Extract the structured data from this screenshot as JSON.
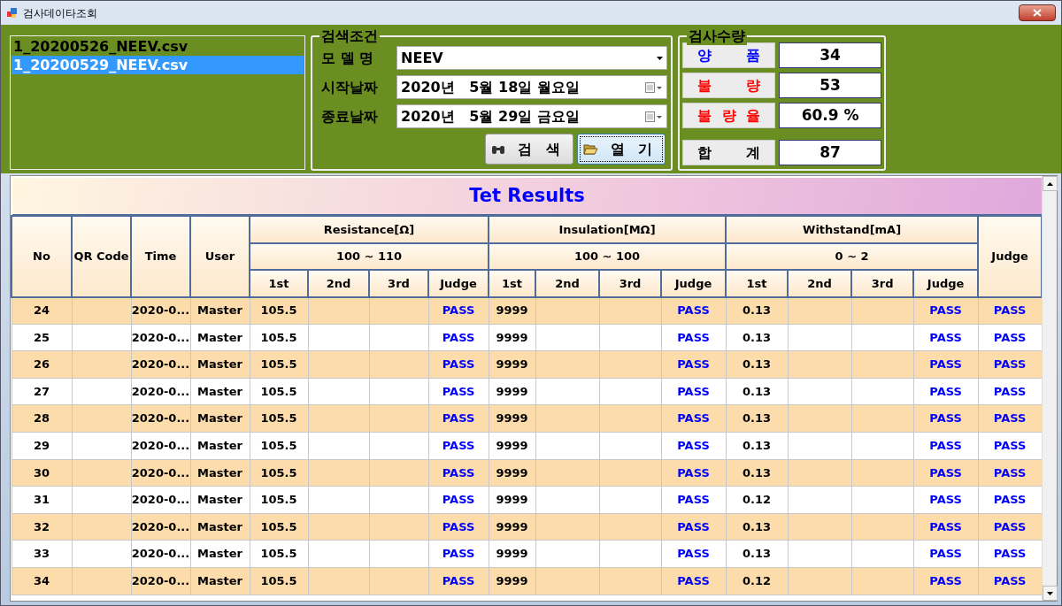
{
  "window": {
    "title": "검사데이타조회"
  },
  "file_list": [
    {
      "name": "1_20200526_NEEV.csv",
      "selected": false
    },
    {
      "name": "1_20200529_NEEV.csv",
      "selected": true
    }
  ],
  "search_conditions": {
    "title": "검색조건",
    "fields": [
      {
        "label": "모 델 명",
        "value": "NEEV",
        "kind": "dropdown"
      },
      {
        "label": "시작날짜",
        "value": "2020년   5월 18일 월요일",
        "kind": "date"
      },
      {
        "label": "종료날짜",
        "value": "2020년   5월 29일 금요일",
        "kind": "date"
      }
    ],
    "buttons": [
      {
        "label": "검 색",
        "kind": "search",
        "focused": false
      },
      {
        "label": "열 기",
        "kind": "open",
        "focused": true
      }
    ]
  },
  "inspection_counts": {
    "title": "검사수량",
    "items": [
      {
        "label": "양 품",
        "value": "34",
        "color": "#0000ff"
      },
      {
        "label": "불 량",
        "value": "53",
        "color": "#ff0000"
      },
      {
        "label": "불 량 율",
        "value": "60.9 %",
        "color": "#ff0000"
      },
      {
        "label": "합 계",
        "value": "87",
        "color": "#000000"
      }
    ]
  },
  "results": {
    "title": "Tet Results",
    "fixed_columns": [
      "No",
      "QR Code",
      "Time",
      "User"
    ],
    "groups": [
      {
        "name": "Resistance[Ω]",
        "range": "100 ~ 110",
        "subcolumns": [
          "1st",
          "2nd",
          "3rd",
          "Judge"
        ]
      },
      {
        "name": "Insulation[MΩ]",
        "range": "100 ~ 100",
        "subcolumns": [
          "1st",
          "2nd",
          "3rd",
          "Judge"
        ]
      },
      {
        "name": "Withstand[mA]",
        "range": "0 ~ 2",
        "subcolumns": [
          "1st",
          "2nd",
          "3rd",
          "Judge"
        ]
      }
    ],
    "final_column": "Judge",
    "rows": [
      {
        "no": "24",
        "time": "2020-0...",
        "user": "Master",
        "resistance_1st": "105.5",
        "resistance_judge": "PASS",
        "insulation_1st": "9999",
        "insulation_judge": "PASS",
        "withstand_1st": "0.13",
        "withstand_judge": "PASS",
        "judge": "PASS"
      },
      {
        "no": "25",
        "time": "2020-0...",
        "user": "Master",
        "resistance_1st": "105.5",
        "resistance_judge": "PASS",
        "insulation_1st": "9999",
        "insulation_judge": "PASS",
        "withstand_1st": "0.13",
        "withstand_judge": "PASS",
        "judge": "PASS"
      },
      {
        "no": "26",
        "time": "2020-0...",
        "user": "Master",
        "resistance_1st": "105.5",
        "resistance_judge": "PASS",
        "insulation_1st": "9999",
        "insulation_judge": "PASS",
        "withstand_1st": "0.13",
        "withstand_judge": "PASS",
        "judge": "PASS"
      },
      {
        "no": "27",
        "time": "2020-0...",
        "user": "Master",
        "resistance_1st": "105.5",
        "resistance_judge": "PASS",
        "insulation_1st": "9999",
        "insulation_judge": "PASS",
        "withstand_1st": "0.13",
        "withstand_judge": "PASS",
        "judge": "PASS"
      },
      {
        "no": "28",
        "time": "2020-0...",
        "user": "Master",
        "resistance_1st": "105.5",
        "resistance_judge": "PASS",
        "insulation_1st": "9999",
        "insulation_judge": "PASS",
        "withstand_1st": "0.13",
        "withstand_judge": "PASS",
        "judge": "PASS"
      },
      {
        "no": "29",
        "time": "2020-0...",
        "user": "Master",
        "resistance_1st": "105.5",
        "resistance_judge": "PASS",
        "insulation_1st": "9999",
        "insulation_judge": "PASS",
        "withstand_1st": "0.13",
        "withstand_judge": "PASS",
        "judge": "PASS"
      },
      {
        "no": "30",
        "time": "2020-0...",
        "user": "Master",
        "resistance_1st": "105.5",
        "resistance_judge": "PASS",
        "insulation_1st": "9999",
        "insulation_judge": "PASS",
        "withstand_1st": "0.13",
        "withstand_judge": "PASS",
        "judge": "PASS"
      },
      {
        "no": "31",
        "time": "2020-0...",
        "user": "Master",
        "resistance_1st": "105.5",
        "resistance_judge": "PASS",
        "insulation_1st": "9999",
        "insulation_judge": "PASS",
        "withstand_1st": "0.12",
        "withstand_judge": "PASS",
        "judge": "PASS"
      },
      {
        "no": "32",
        "time": "2020-0...",
        "user": "Master",
        "resistance_1st": "105.5",
        "resistance_judge": "PASS",
        "insulation_1st": "9999",
        "insulation_judge": "PASS",
        "withstand_1st": "0.13",
        "withstand_judge": "PASS",
        "judge": "PASS"
      },
      {
        "no": "33",
        "time": "2020-0...",
        "user": "Master",
        "resistance_1st": "105.5",
        "resistance_judge": "PASS",
        "insulation_1st": "9999",
        "insulation_judge": "PASS",
        "withstand_1st": "0.13",
        "withstand_judge": "PASS",
        "judge": "PASS"
      },
      {
        "no": "34",
        "time": "2020-0...",
        "user": "Master",
        "resistance_1st": "105.5",
        "resistance_judge": "PASS",
        "insulation_1st": "9999",
        "insulation_judge": "PASS",
        "withstand_1st": "0.12",
        "withstand_judge": "PASS",
        "judge": "PASS"
      }
    ]
  }
}
